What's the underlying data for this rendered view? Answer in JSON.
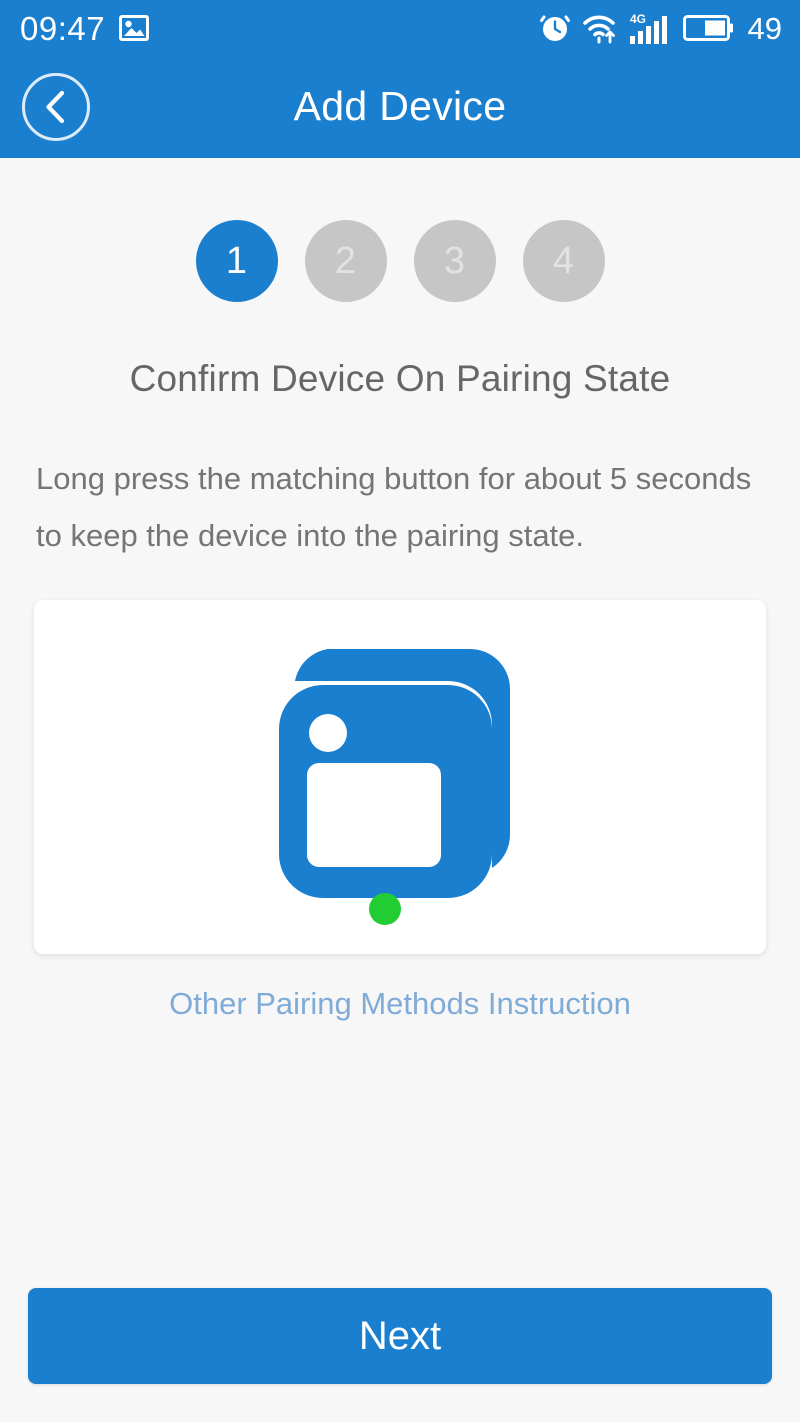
{
  "status_bar": {
    "time": "09:47",
    "battery_percent": "49",
    "icons": {
      "gallery": "gallery-icon",
      "alarm": "alarm-clock-icon",
      "wifi": "wifi-icon",
      "network_type": "4G",
      "signal": "signal-bars-icon",
      "battery": "battery-icon"
    }
  },
  "header": {
    "title": "Add Device",
    "back_icon": "chevron-left-icon"
  },
  "steps": [
    {
      "label": "1",
      "active": true
    },
    {
      "label": "2",
      "active": false
    },
    {
      "label": "3",
      "active": false
    },
    {
      "label": "4",
      "active": false
    }
  ],
  "main": {
    "section_title": "Confirm Device On Pairing State",
    "description": "Long press the matching button for about 5 seconds to keep the device into the pairing state.",
    "illustration": "device-stack-icon",
    "link_label": "Other Pairing Methods Instruction"
  },
  "footer": {
    "next_label": "Next"
  },
  "colors": {
    "brand_blue": "#1b7fd0",
    "device_blue": "#1b7fd0",
    "status_green": "#22cc33",
    "step_inactive": "#c6c6c6",
    "link_blue": "#7fabd8",
    "page_background": "#f7f7f7"
  }
}
